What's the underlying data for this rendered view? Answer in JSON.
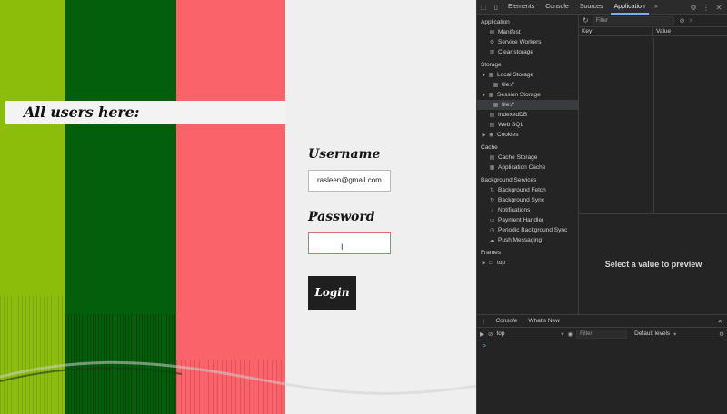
{
  "page": {
    "users_heading": "All users here:",
    "username_label": "Username",
    "username_value": "rasleen@gmail.com",
    "password_label": "Password",
    "password_value": "",
    "login_label": "Login",
    "colors": {
      "lime": "#8cbd0a",
      "green": "#045f0c",
      "pink": "#fb636a",
      "light": "#efefef"
    }
  },
  "devtools": {
    "tabs": [
      "Elements",
      "Console",
      "Sources",
      "Application"
    ],
    "active_tab": "Application",
    "more": "»",
    "sidebar": {
      "application_title": "Application",
      "application_items": [
        "Manifest",
        "Service Workers",
        "Clear storage"
      ],
      "storage_title": "Storage",
      "local_storage": "Local Storage",
      "local_storage_child": "file://",
      "session_storage": "Session Storage",
      "session_storage_child": "file://",
      "indexeddb": "IndexedDB",
      "websql": "Web SQL",
      "cookies": "Cookies",
      "cache_title": "Cache",
      "cache_items": [
        "Cache Storage",
        "Application Cache"
      ],
      "bg_title": "Background Services",
      "bg_items": [
        "Background Fetch",
        "Background Sync",
        "Notifications",
        "Payment Handler",
        "Periodic Background Sync",
        "Push Messaging"
      ],
      "frames_title": "Frames",
      "frames_top": "top"
    },
    "storage_view": {
      "filter_placeholder": "Filter",
      "col_key": "Key",
      "col_value": "Value",
      "preview": "Select a value to preview"
    },
    "drawer": {
      "tab_console": "Console",
      "tab_whats_new": "What's New",
      "context": "top",
      "filter_placeholder": "Filter",
      "levels": "Default levels",
      "prompt": ">"
    }
  }
}
